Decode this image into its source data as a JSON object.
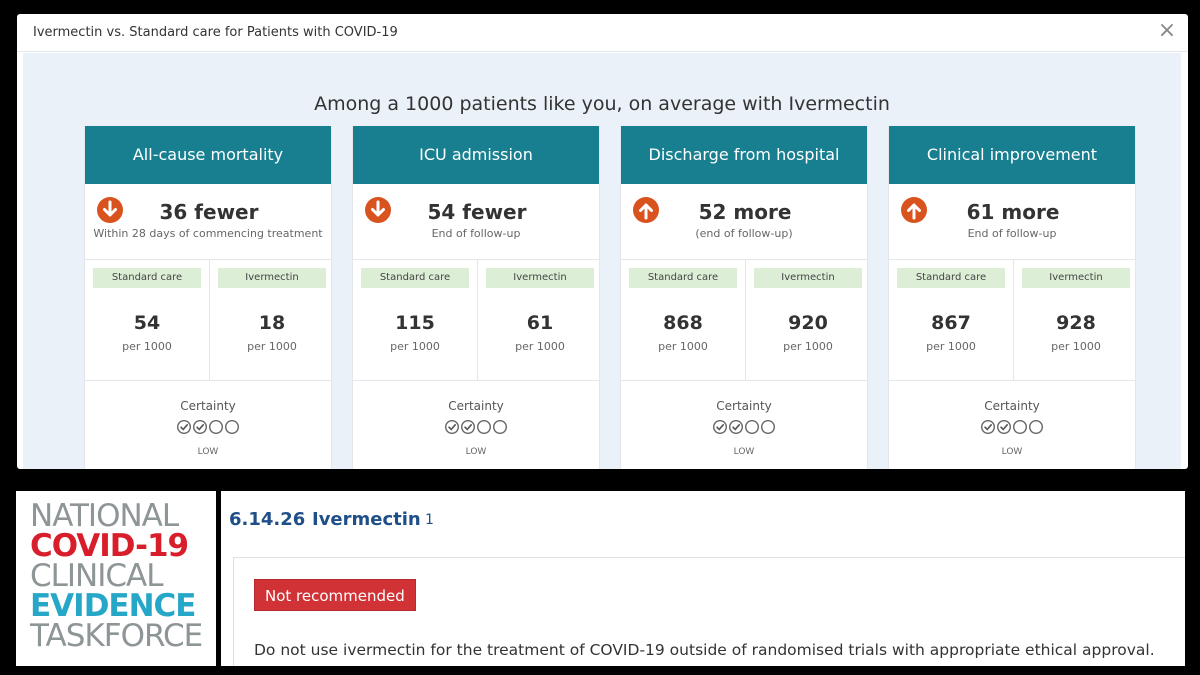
{
  "modal": {
    "title": "Ivermectin vs. Standard care for Patients with COVID-19",
    "close_glyph": "×",
    "headline": "Among a 1000 patients like you, on average with Ivermectin"
  },
  "outcomes": [
    {
      "name": "All-cause mortality",
      "direction": "down",
      "icon": "arrow-down-icon",
      "effect": "36 fewer",
      "timeframe": "Within 28 days of commencing treatment",
      "control_label": "Standard care",
      "control_value": "54",
      "control_unit": "per 1000",
      "intervention_label": "Ivermectin",
      "intervention_value": "18",
      "intervention_unit": "per 1000",
      "certainty_label": "Certainty",
      "certainty_level": "LOW",
      "certainty_score": 2
    },
    {
      "name": "ICU admission",
      "direction": "down",
      "icon": "arrow-down-icon",
      "effect": "54 fewer",
      "timeframe": "End of follow-up",
      "control_label": "Standard care",
      "control_value": "115",
      "control_unit": "per 1000",
      "intervention_label": "Ivermectin",
      "intervention_value": "61",
      "intervention_unit": "per 1000",
      "certainty_label": "Certainty",
      "certainty_level": "LOW",
      "certainty_score": 2
    },
    {
      "name": "Discharge from hospital",
      "direction": "up",
      "icon": "arrow-up-icon",
      "effect": "52 more",
      "timeframe": "(end of follow-up)",
      "control_label": "Standard care",
      "control_value": "868",
      "control_unit": "per 1000",
      "intervention_label": "Ivermectin",
      "intervention_value": "920",
      "intervention_unit": "per 1000",
      "certainty_label": "Certainty",
      "certainty_level": "LOW",
      "certainty_score": 2
    },
    {
      "name": "Clinical improvement",
      "direction": "up",
      "icon": "arrow-up-icon",
      "effect": "61 more",
      "timeframe": "End of follow-up",
      "control_label": "Standard care",
      "control_value": "867",
      "control_unit": "per 1000",
      "intervention_label": "Ivermectin",
      "intervention_value": "928",
      "intervention_unit": "per 1000",
      "certainty_label": "Certainty",
      "certainty_level": "LOW",
      "certainty_score": 2
    }
  ],
  "logo": {
    "line1": "NATIONAL",
    "line2": "COVID-19",
    "line3": "CLINICAL",
    "line4": "EVIDENCE",
    "line5": "TASKFORCE"
  },
  "recommendation": {
    "number": "6.14.26",
    "title": "Ivermectin",
    "version": "1",
    "badge": "Not recommended",
    "text": "Do not use ivermectin for the treatment of COVID-19 outside of randomised trials with appropriate ethical approval."
  },
  "colors": {
    "header_teal": "#177f8f",
    "arrow_orange": "#d9531e",
    "pill_green": "#ddeed6",
    "badge_red": "#d03235",
    "heading_blue": "#1e4f87",
    "logo_red": "#d71e2a",
    "logo_teal": "#27a7c8",
    "logo_grey": "#8e9597"
  }
}
